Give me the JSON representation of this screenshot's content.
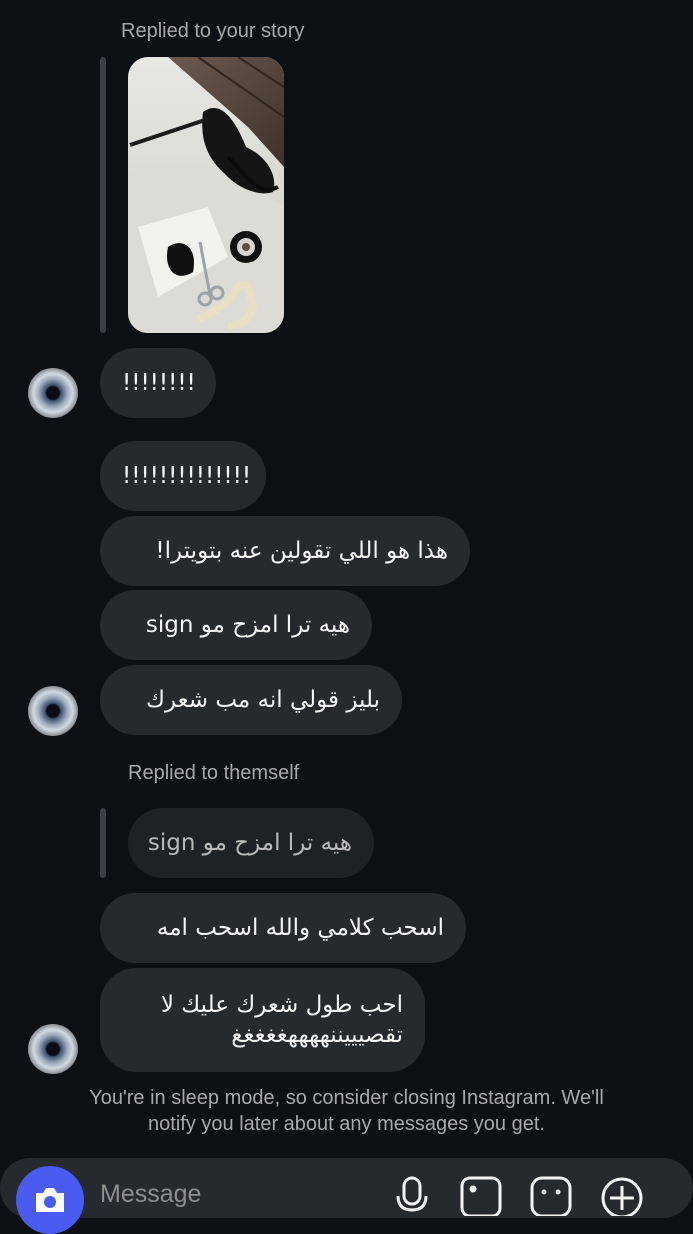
{
  "thread": {
    "story_reply": {
      "label": "Replied to your story"
    },
    "messages": [
      {
        "text": "!!!!!!!!"
      },
      {
        "text": "!!!!!!!!!!!!!!"
      },
      {
        "text": "هذا هو اللي تقولين عنه بتويترا!"
      },
      {
        "text": "هيه ترا امزح مو sign"
      },
      {
        "text": "بليز قولي انه مب شعرك"
      }
    ],
    "self_reply": {
      "label": "Replied to themself",
      "quoted": "هيه ترا امزح مو sign"
    },
    "messages_after": [
      {
        "text": "اسحب كلامي والله اسحب امه"
      },
      {
        "line1": "احب طول شعرك عليك لا",
        "line2": "تقصيييننههههغغغغغ"
      }
    ]
  },
  "sleep_mode": {
    "line1": "You're in sleep mode, so consider closing Instagram. We'll",
    "line2": "notify you later about any messages you get."
  },
  "composer": {
    "placeholder": "Message",
    "icons": [
      "camera-icon",
      "microphone-icon",
      "image-icon",
      "sticker-icon",
      "plus-icon"
    ]
  },
  "colors": {
    "background": "#0c1014",
    "bubble": "#262a2f",
    "meta_text": "#a8a8a8",
    "camera_button": "#4a5cf0"
  }
}
